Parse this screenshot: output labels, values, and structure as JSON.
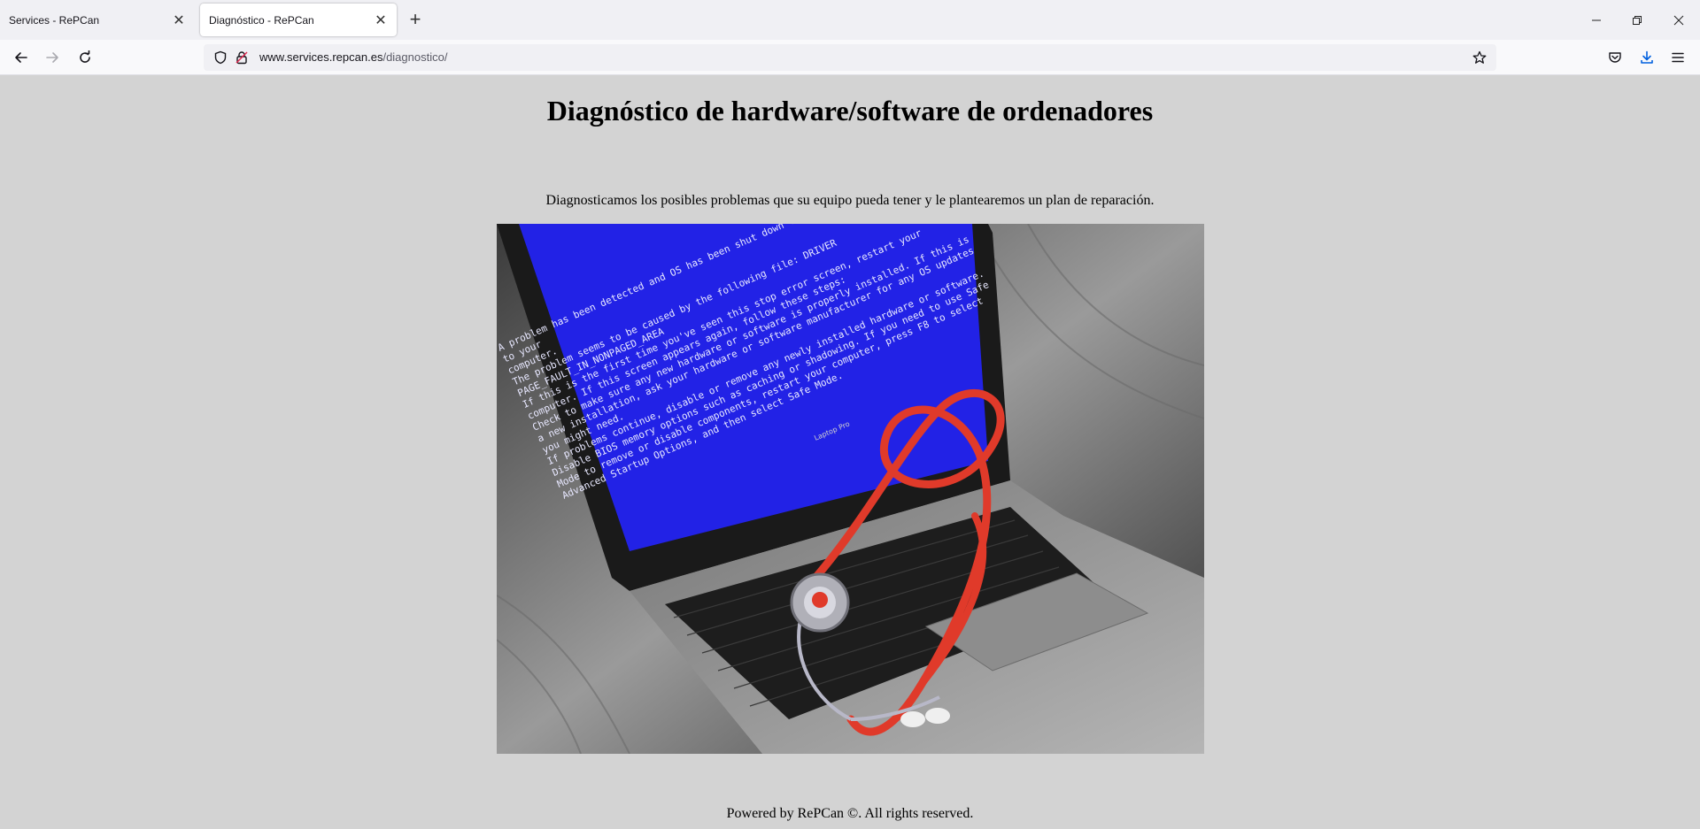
{
  "browser": {
    "tabs": [
      {
        "title": "Services - RePCan",
        "active": false
      },
      {
        "title": "Diagnóstico - RePCan",
        "active": true
      }
    ],
    "new_tab_icon": "plus-icon",
    "url": {
      "domain": "www.services.repcan.es",
      "path": "/diagnostico/"
    },
    "icons": [
      "back-arrow-icon",
      "forward-arrow-icon",
      "reload-icon",
      "shield-icon",
      "lock-icon",
      "star-icon",
      "pocket-icon",
      "download-icon",
      "hamburger-menu-icon"
    ],
    "accent_color": "#0060df"
  },
  "page": {
    "title": "Diagnóstico de hardware/software de ordenadores",
    "intro": "Diagnosticamos los posibles problemas que su equipo pueda tener y le plantearemos un plan de reparación.",
    "hero_image": {
      "screen_color": "#2222e6",
      "laptop_label": "Laptop Pro",
      "bsod_lines": [
        "A problem has been detected and OS has been shut down to prevent damage",
        "to your",
        "computer.",
        "The problem seems to be caused by the following file: DRIVER",
        "PAGE_FAULT_IN_NONPAGED_AREA",
        "If this is the first time you've seen this stop error screen, restart your",
        "computer. If this screen appears again, follow these steps:",
        "Check to make sure any new hardware or software is properly installed. If this is",
        "a new installation, ask your hardware or software manufacturer for any OS updates",
        "you might need.",
        "If problems continue, disable or remove any newly installed hardware or software.",
        "Disable BIOS memory options such as caching or shadowing. If you need to use Safe",
        "Mode to remove or disable components, restart your computer, press F8 to select",
        "Advanced Startup Options, and then select Safe Mode."
      ]
    },
    "footer": "Powered by RePCan ©. All rights reserved."
  }
}
